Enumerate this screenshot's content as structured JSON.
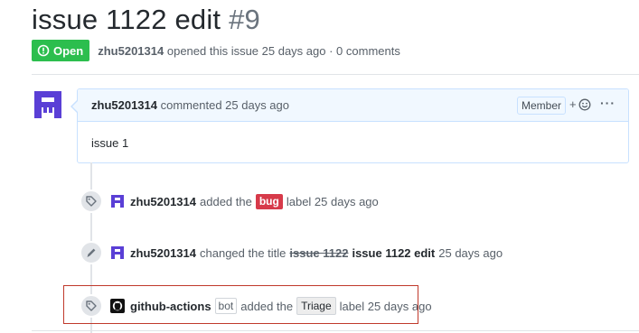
{
  "issue": {
    "title": "issue 1122 edit",
    "number": "#9",
    "state": "Open",
    "author": "zhu5201314",
    "opened_text": "opened this issue 25 days ago · 0 comments"
  },
  "comment": {
    "author": "zhu5201314",
    "action": "commented 25 days ago",
    "role_badge": "Member",
    "react_label": "+",
    "more_label": "···",
    "body": "issue 1"
  },
  "events": [
    {
      "actor": "zhu5201314",
      "text_before": "added the",
      "label": "bug",
      "text_after": "label 25 days ago"
    },
    {
      "actor": "zhu5201314",
      "text_before": "changed the title",
      "old_title": "issue 1122",
      "new_title": "issue 1122 edit",
      "text_after": "25 days ago"
    },
    {
      "actor": "github-actions",
      "bot_badge": "bot",
      "text_before": "added the",
      "label": "Triage",
      "text_after": "label 25 days ago"
    }
  ],
  "colors": {
    "open_green": "#2cbe4e",
    "bug_red": "#d73a4a",
    "triage_gray": "#ededed",
    "avatar_purple": "#5a3fd6",
    "highlight_red": "#c0392b"
  },
  "icons": {
    "state": "issue-opened-icon",
    "label_event": "tag-icon",
    "rename_event": "pencil-icon",
    "reaction": "smiley-icon",
    "bot_avatar": "github-logo-icon"
  }
}
